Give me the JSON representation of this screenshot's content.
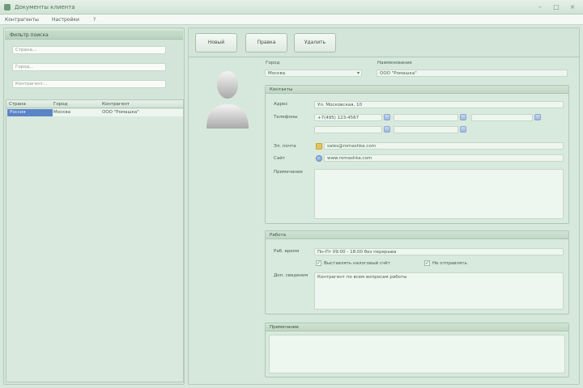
{
  "window": {
    "title": "Документы клиента"
  },
  "menu": {
    "items": [
      "Контрагенты",
      "Настройки",
      "?"
    ]
  },
  "left": {
    "filter_caption": "Фильтр поиска",
    "filters": [
      {
        "placeholder": "Страна..."
      },
      {
        "placeholder": "Город..."
      },
      {
        "placeholder": "Контрагент..."
      }
    ],
    "grid": {
      "headers": [
        "Страна",
        "Город",
        "Контрагент"
      ],
      "rows": [
        {
          "country": "Россия",
          "city": "Москва",
          "counterparty": "ООО \"Ромашка\""
        }
      ]
    }
  },
  "toolbar": {
    "buttons": [
      "Новый",
      "Правка",
      "Удалить"
    ]
  },
  "card": {
    "city_label": "Город",
    "city_value": "Москва",
    "org_label": "Наименование",
    "org_value": "ООО \"Ромашка\"",
    "contacts": {
      "caption": "Контакты",
      "address_label": "Адрес",
      "address_value": "Ул. Московская, 10",
      "phones_label": "Телефоны",
      "phone_1": "+7(495) 123-4567",
      "email_label": "Эл. почта",
      "email_value": "sales@romashka.com",
      "site_label": "Сайт",
      "site_value": "www.romashka.com",
      "notes_label": "Примечание",
      "notes_value": ""
    },
    "work": {
      "caption": "Работа",
      "time_label": "Раб. время",
      "time_value": "Пн-Пт 09:00 - 18:00 без перерыва",
      "check_1_label": "Выставлять налоговый счёт",
      "check_2_label": "Не отправлять",
      "extra_label": "Доп. сведения",
      "extra_value": "Контрагент по всем вопросам работы"
    },
    "notes_box": {
      "caption": "Примечание"
    }
  }
}
